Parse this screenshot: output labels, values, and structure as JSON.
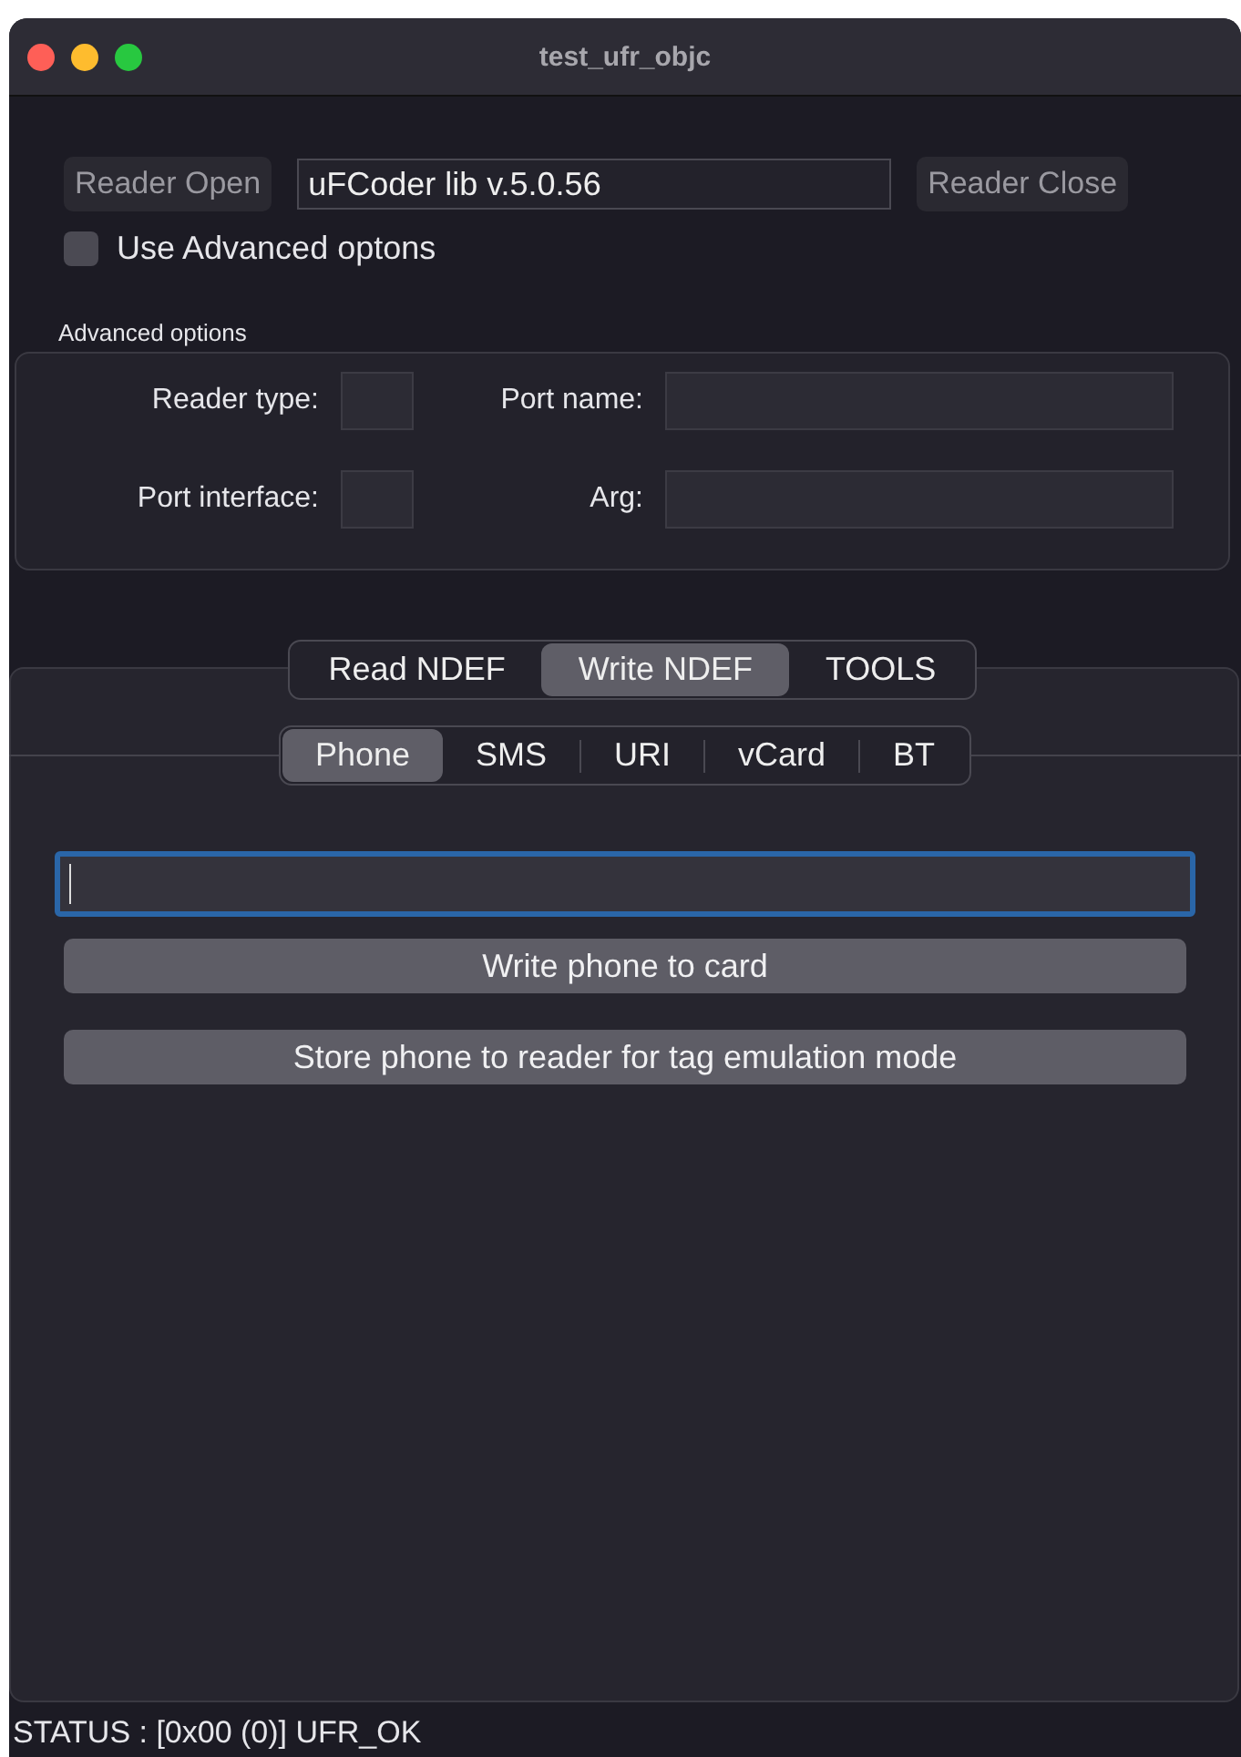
{
  "window": {
    "title": "test_ufr_objc"
  },
  "top": {
    "open_button": "Reader Open",
    "lib_field": "uFCoder lib v.5.0.56",
    "close_button": "Reader Close"
  },
  "advanced_checkbox": {
    "label": "Use Advanced optons",
    "checked": false
  },
  "advanced_group": {
    "title": "Advanced options",
    "fields": [
      {
        "label": "Reader type:",
        "kind": "short"
      },
      {
        "label": "Port name:",
        "kind": "long"
      },
      {
        "label": "Port interface:",
        "kind": "short"
      },
      {
        "label": "Arg:",
        "kind": "long"
      }
    ]
  },
  "tabs": [
    {
      "label": "Read NDEF",
      "selected": false
    },
    {
      "label": "Write NDEF",
      "selected": true
    },
    {
      "label": "TOOLS",
      "selected": false
    }
  ],
  "subtabs": [
    {
      "label": "Phone",
      "selected": true
    },
    {
      "label": "SMS",
      "selected": false
    },
    {
      "label": "URI",
      "selected": false
    },
    {
      "label": "vCard",
      "selected": false
    },
    {
      "label": "BT",
      "selected": false
    }
  ],
  "phone_field": {
    "focused": true
  },
  "buttons": [
    "Write phone to card",
    "Store phone to reader for tag emulation mode"
  ],
  "status_bar": "STATUS :  [0x00 (0)] UFR_OK"
}
